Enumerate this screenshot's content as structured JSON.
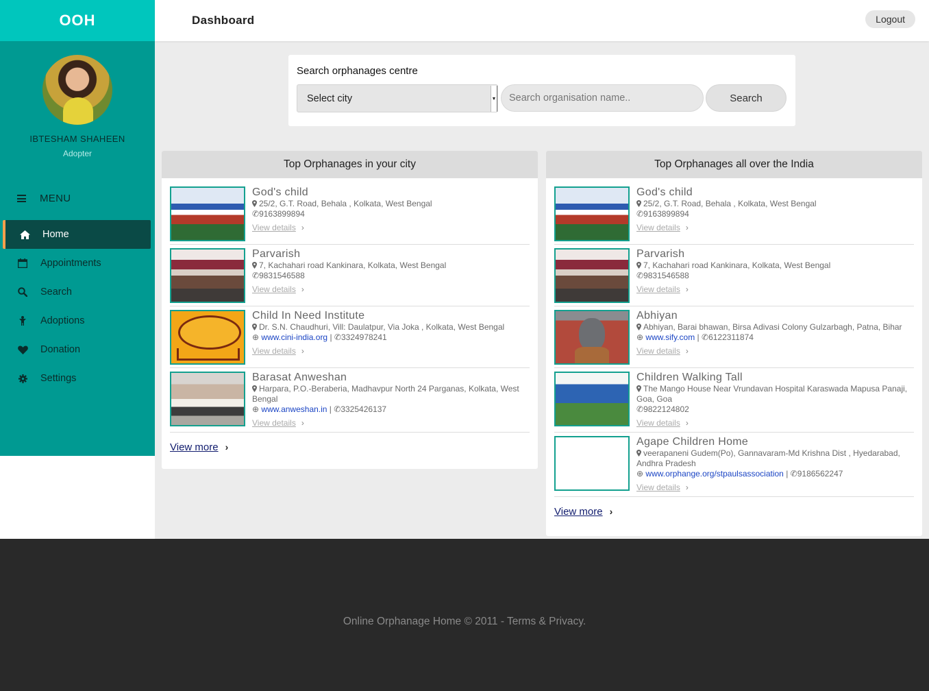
{
  "app": {
    "brand": "OOH"
  },
  "header": {
    "title": "Dashboard",
    "logout_label": "Logout"
  },
  "user": {
    "name": "IBTESHAM SHAHEEN",
    "role": "Adopter"
  },
  "menu": {
    "heading": "MENU",
    "items": [
      {
        "label": "Home",
        "icon": "home-icon",
        "active": true
      },
      {
        "label": "Appointments",
        "icon": "calendar-icon"
      },
      {
        "label": "Search",
        "icon": "search-icon"
      },
      {
        "label": "Adoptions",
        "icon": "child-icon"
      },
      {
        "label": "Donation",
        "icon": "heart-icon"
      },
      {
        "label": "Settings",
        "icon": "gear-icon"
      }
    ]
  },
  "search": {
    "heading": "Search orphanages centre",
    "city_selected": "Select city",
    "org_placeholder": "Search organisation name..",
    "button_label": "Search"
  },
  "left_panel": {
    "title": "Top Orphanages in your city",
    "view_more": "View more",
    "items": [
      {
        "name": "God's child",
        "address": "25/2, G.T. Road, Behala , Kolkata, West Bengal",
        "website": "",
        "phone": "9163899894",
        "details": "View details"
      },
      {
        "name": "Parvarish",
        "address": "7, Kachahari road Kankinara, Kolkata, West Bengal",
        "website": "",
        "phone": "9831546588",
        "details": "View details"
      },
      {
        "name": "Child In Need Institute",
        "address": "Dr. S.N. Chaudhuri, Vill: Daulatpur, Via Joka , Kolkata, West Bengal",
        "website": "www.cini-india.org",
        "phone": "3324978241",
        "details": "View details"
      },
      {
        "name": "Barasat Anweshan",
        "address": "Harpara, P.O.-Beraberia, Madhavpur North 24 Parganas, Kolkata, West Bengal",
        "website": "www.anweshan.in",
        "phone": "3325426137",
        "details": "View details"
      }
    ]
  },
  "right_panel": {
    "title": "Top Orphanages all over the India",
    "view_more": "View more",
    "items": [
      {
        "name": "God's child",
        "address": "25/2, G.T. Road, Behala , Kolkata, West Bengal",
        "website": "",
        "phone": "9163899894",
        "details": "View details"
      },
      {
        "name": "Parvarish",
        "address": "7, Kachahari road Kankinara, Kolkata, West Bengal",
        "website": "",
        "phone": "9831546588",
        "details": "View details"
      },
      {
        "name": "Abhiyan",
        "address": "Abhiyan, Barai bhawan, Birsa Adivasi Colony Gulzarbagh, Patna, Bihar",
        "website": "www.sify.com",
        "phone": "6122311874",
        "details": "View details"
      },
      {
        "name": "Children Walking Tall",
        "address": "The Mango House Near Vrundavan Hospital Karaswada Mapusa Panaji, Goa, Goa",
        "website": "",
        "phone": "9822124802",
        "details": "View details"
      },
      {
        "name": "Agape Children Home",
        "address": "veerapaneni Gudem(Po), Gannavaram-Md Krishna Dist , Hyedarabad, Andhra Pradesh",
        "website": "www.orphange.org/stpaulsassociation",
        "phone": "9186562247",
        "details": "View details"
      }
    ]
  },
  "footer": {
    "text": "Online Orphanage Home © 2011 - Terms & Privacy."
  }
}
